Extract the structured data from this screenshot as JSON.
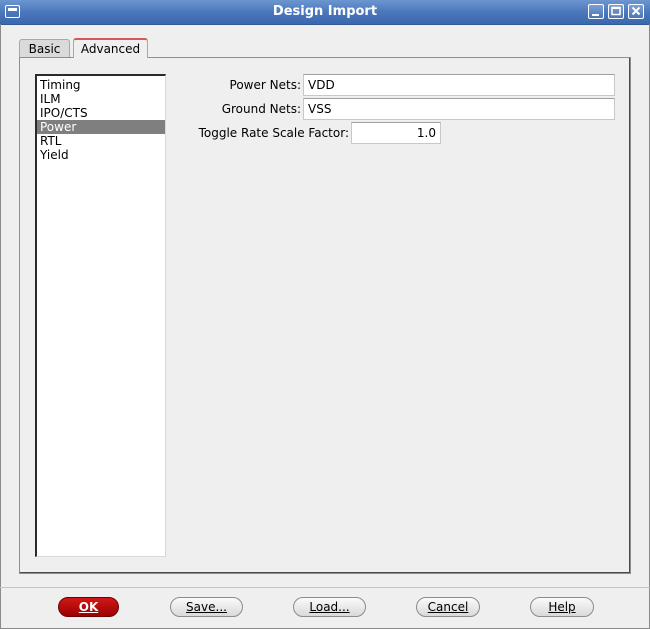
{
  "window": {
    "title": "Design Import"
  },
  "tabs": [
    {
      "label": "Basic"
    },
    {
      "label": "Advanced"
    }
  ],
  "categories": {
    "items": [
      "Timing",
      "ILM",
      "IPO/CTS",
      "Power",
      "RTL",
      "Yield"
    ],
    "selected": "Power"
  },
  "fields": {
    "power_nets": {
      "label": "Power Nets:",
      "value": "VDD"
    },
    "ground_nets": {
      "label": "Ground Nets:",
      "value": "VSS"
    },
    "toggle_rate": {
      "label": "Toggle Rate Scale Factor:",
      "value": "1.0"
    }
  },
  "buttons": {
    "ok": "OK",
    "save": "Save...",
    "load": "Load...",
    "cancel": "Cancel",
    "help": "Help"
  },
  "colors": {
    "titlebar": "#4b78bd",
    "primary_button": "#b80000",
    "active_tab_accent": "#d45a5a",
    "selection": "#7f7f7f"
  }
}
